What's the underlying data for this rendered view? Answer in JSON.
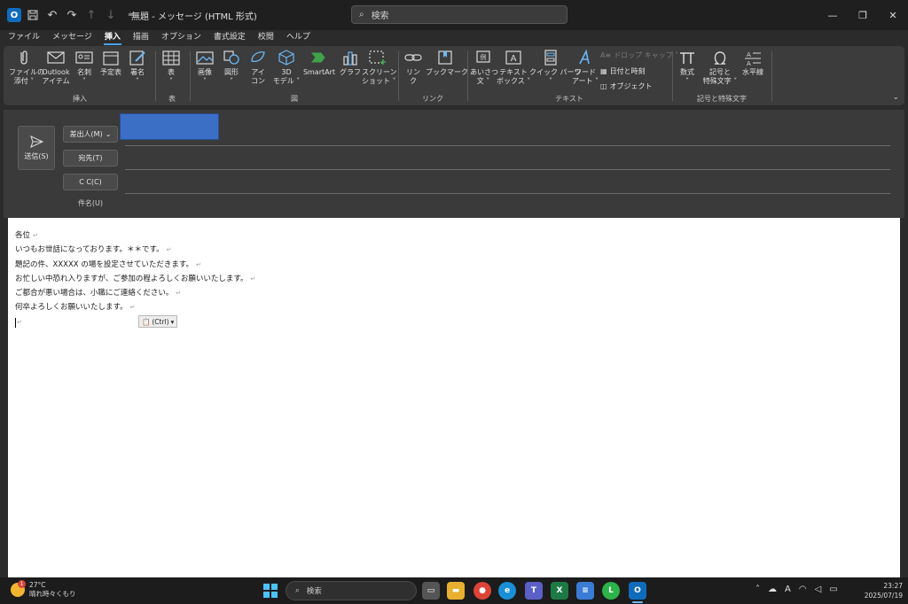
{
  "titlebar": {
    "title": "無題 - メッセージ (HTML 形式)",
    "search_placeholder": "検索",
    "app_icon_label": "O"
  },
  "menu_tabs": [
    "ファイル",
    "メッセージ",
    "挿入",
    "描画",
    "オプション",
    "書式設定",
    "校閲",
    "ヘルプ"
  ],
  "active_tab": "挿入",
  "ribbon": {
    "groups": {
      "insert": "挿入",
      "table": "表",
      "illustrations": "図",
      "links": "リンク",
      "text": "テキスト",
      "symbols": "記号と特殊文字"
    },
    "buttons": {
      "attach": "ファイルの\n添付 ˅",
      "outlook_item": "Outlook\nアイテム",
      "business_card": "名刺\n˅",
      "calendar": "予定表",
      "signature": "署名\n˅",
      "table": "表\n˅",
      "pictures": "画像\n˅",
      "shapes": "図形\n˅",
      "icons": "アイ\nコン",
      "models3d": "3D\nモデル ˅",
      "smartart": "SmartArt",
      "chart": "グラフ",
      "screenshot": "スクリーン\nショット ˅",
      "link": "リン\nク",
      "bookmark": "ブックマーク",
      "greeting": "あいさつ\n文 ˅",
      "textbox": "テキスト\nボックス ˅",
      "quick_parts": "クイック パーツ\n˅",
      "wordart": "ワード\nアート ˅",
      "equation": "数式\n˅",
      "symbol": "記号と\n特殊文字 ˅",
      "horizontal_line": "水平線"
    },
    "small_buttons": {
      "drop_cap": "ドロップ キャップ ˅",
      "date_time": "日付と時刻",
      "object": "オブジェクト"
    }
  },
  "header": {
    "send": "送信(S)",
    "from": "差出人(M)",
    "to": "宛先(T)",
    "cc": "C C(C)",
    "subject": "件名(U)"
  },
  "body": {
    "lines": [
      "各位",
      "いつもお世話になっております。＊＊です。",
      "題記の件、XXXXX の場を設定させていただきます。",
      "お忙しい中恐れ入りますが、ご参加の程よろしくお願いいたします。",
      "ご都合が悪い場合は、小職にご連絡ください。",
      "何卒よろしくお願いいたします。"
    ],
    "paragraph_mark": "↵",
    "paste_options": "(Ctrl)"
  },
  "taskbar": {
    "temperature": "27°C",
    "weather": "晴れ時々くもり",
    "weather_badge": "1",
    "search": "検索",
    "time": "23:27",
    "date": "2025/07/19"
  },
  "colors": {
    "accent": "#4a9fe8",
    "from_field_fill": "#3b6fc6"
  }
}
